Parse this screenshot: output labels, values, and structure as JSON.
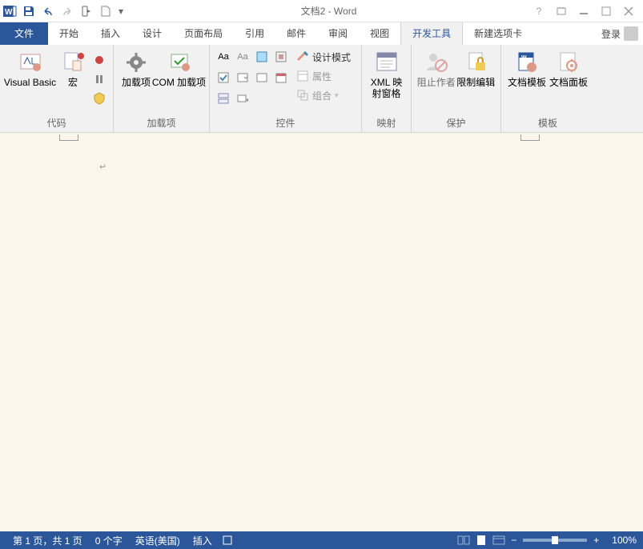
{
  "title": "文档2 - Word",
  "qa_tooltip_dropdown": "▾",
  "tabs": {
    "file": "文件",
    "items": [
      "开始",
      "插入",
      "设计",
      "页面布局",
      "引用",
      "邮件",
      "审阅",
      "视图",
      "开发工具",
      "新建选项卡"
    ],
    "active_index": 8,
    "login": "登录"
  },
  "ribbon": {
    "groups": {
      "code": {
        "label": "代码",
        "visual_basic": "Visual Basic",
        "macros": "宏"
      },
      "addins": {
        "label": "加载项",
        "addins": "加载项",
        "com_addins": "COM 加载项"
      },
      "controls": {
        "label": "控件",
        "design_mode": "设计模式",
        "properties": "属性",
        "group": "组合"
      },
      "mapping": {
        "label": "映射",
        "xml_pane": "XML 映\n射窗格"
      },
      "protect": {
        "label": "保护",
        "block_authors": "阻止作者",
        "restrict_editing": "限制编辑"
      },
      "templates": {
        "label": "模板",
        "doc_template": "文档模板",
        "doc_panel": "文档面板"
      }
    }
  },
  "status": {
    "page": "第 1 页，共 1 页",
    "words": "0 个字",
    "language": "英语(美国)",
    "mode": "插入",
    "zoom": "100%"
  },
  "colors": {
    "accent": "#2b579a"
  }
}
